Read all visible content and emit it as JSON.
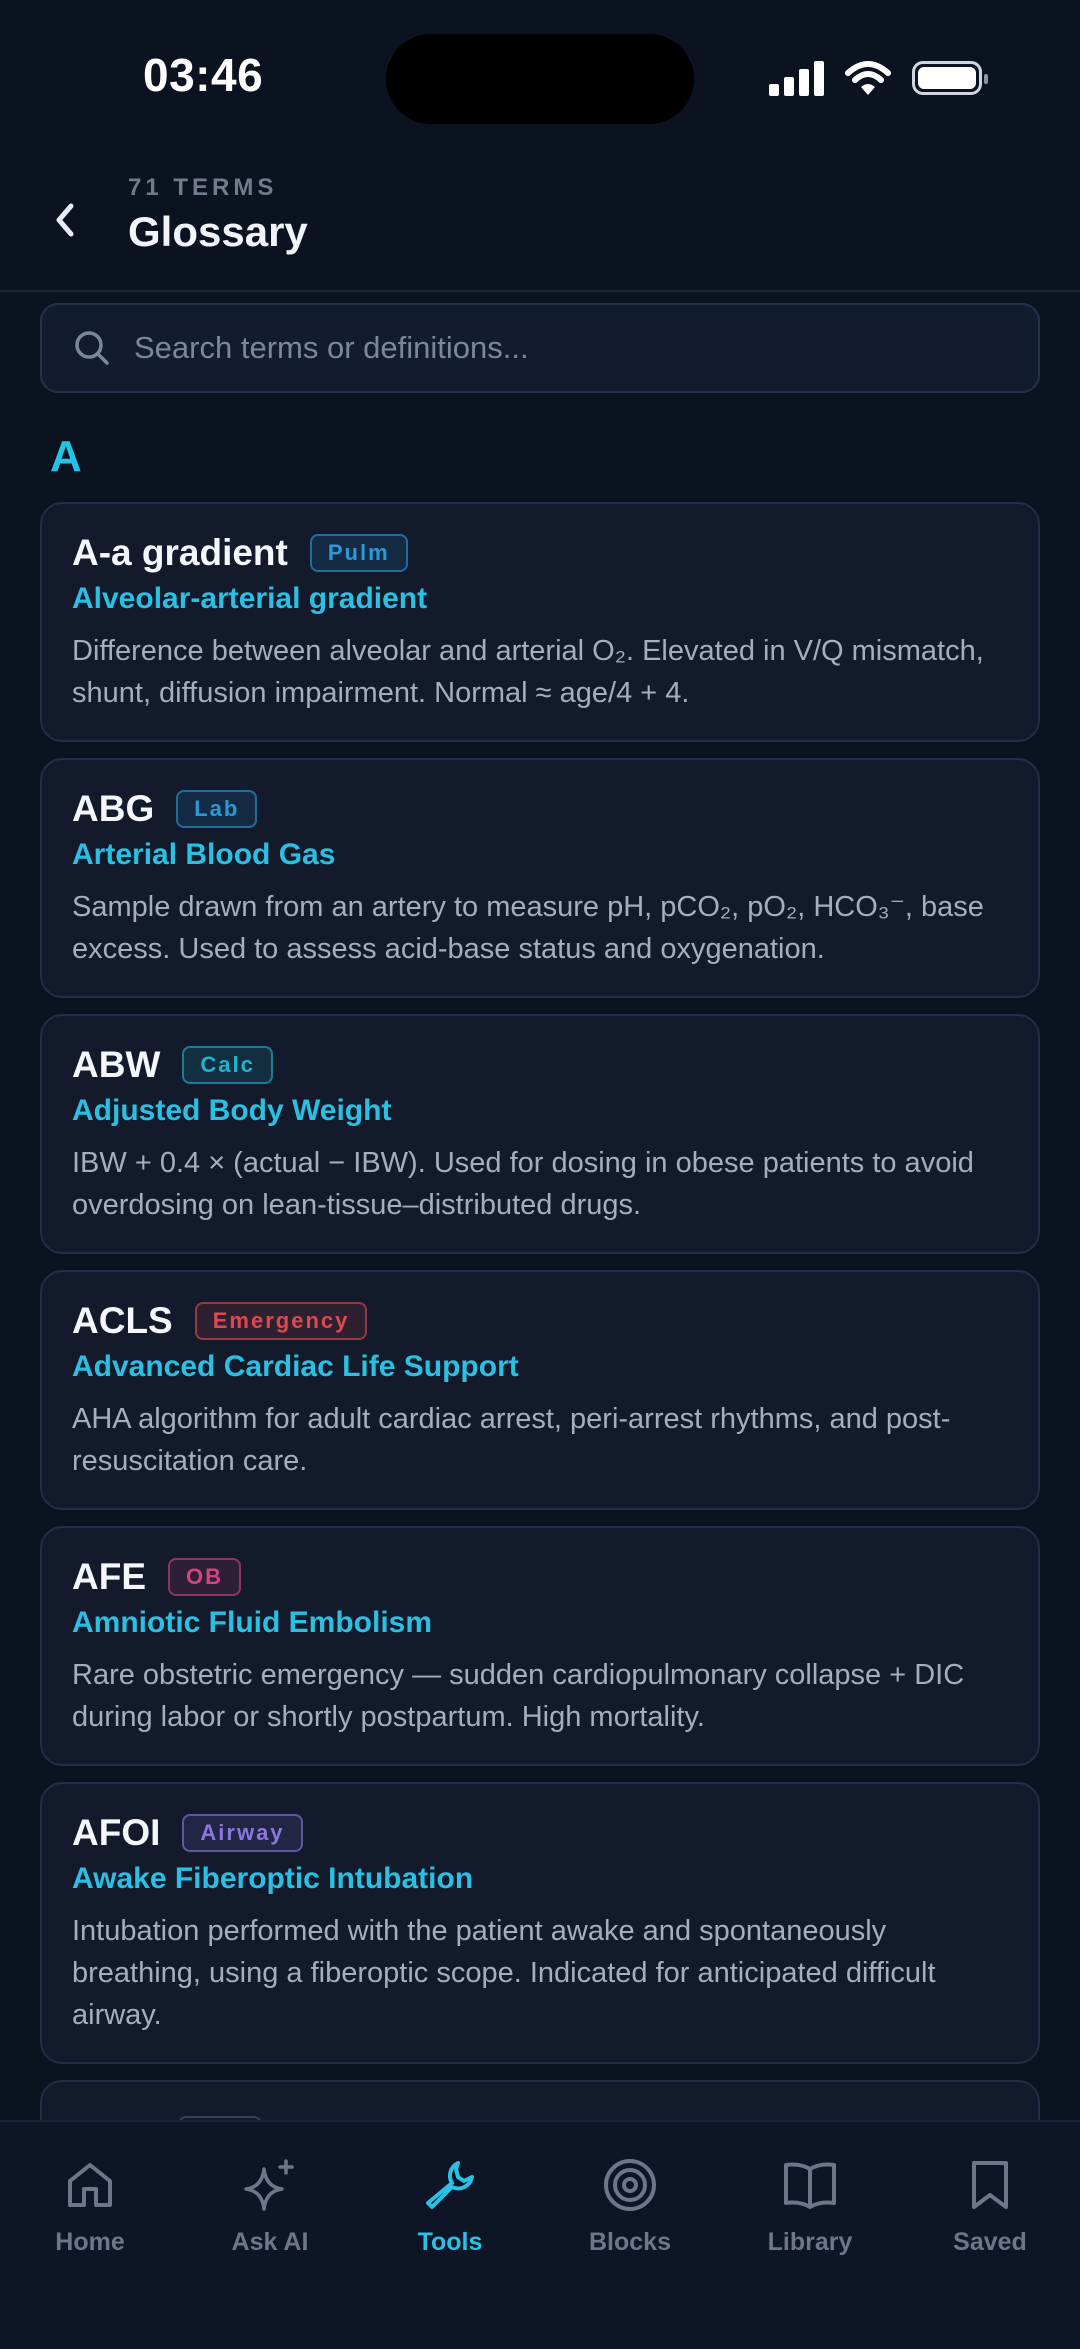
{
  "status_bar": {
    "time": "03:46"
  },
  "header": {
    "count_label": "71 TERMS",
    "title": "Glossary"
  },
  "search": {
    "placeholder": "Search terms or definitions...",
    "value": ""
  },
  "section": {
    "letter": "A"
  },
  "colors": {
    "accent": "#22c3e6",
    "background": "#0b1220",
    "card": "#121a2c"
  },
  "terms": [
    {
      "term": "A-a gradient",
      "tag": "Pulm",
      "tag_color": "#2b9ad6",
      "full_name": "Alveolar-arterial gradient",
      "definition": "Difference between alveolar and arterial O₂. Elevated in V/Q mismatch, shunt, diffusion impairment. Normal ≈ age/4 + 4."
    },
    {
      "term": "ABG",
      "tag": "Lab",
      "tag_color": "#2b9ad6",
      "full_name": "Arterial Blood Gas",
      "definition": "Sample drawn from an artery to measure pH, pCO₂, pO₂, HCO₃⁻, base excess. Used to assess acid-base status and oxygenation."
    },
    {
      "term": "ABW",
      "tag": "Calc",
      "tag_color": "#1fb4c9",
      "full_name": "Adjusted Body Weight",
      "definition": "IBW + 0.4 × (actual − IBW). Used for dosing in obese patients to avoid overdosing on lean-tissue–distributed drugs."
    },
    {
      "term": "ACLS",
      "tag": "Emergency",
      "tag_color": "#e0484f",
      "full_name": "Advanced Cardiac Life Support",
      "definition": "AHA algorithm for adult cardiac arrest, peri-arrest rhythms, and post-resuscitation care."
    },
    {
      "term": "AFE",
      "tag": "OB",
      "tag_color": "#d6437f",
      "full_name": "Amniotic Fluid Embolism",
      "definition": "Rare obstetric emergency — sudden cardiopulmonary collapse + DIC during labor or shortly postpartum. High mortality."
    },
    {
      "term": "AFOI",
      "tag": "Airway",
      "tag_color": "#8a78e0",
      "full_name": "Awake Fiberoptic Intubation",
      "definition": "Intubation performed with the patient awake and spontaneously breathing, using a fiberoptic scope. Indicated for anticipated difficult airway."
    }
  ],
  "tabs": [
    {
      "label": "Home",
      "icon": "home-icon",
      "active": false
    },
    {
      "label": "Ask AI",
      "icon": "sparkles-icon",
      "active": false
    },
    {
      "label": "Tools",
      "icon": "wrench-icon",
      "active": true
    },
    {
      "label": "Blocks",
      "icon": "target-icon",
      "active": false
    },
    {
      "label": "Library",
      "icon": "book-icon",
      "active": false
    },
    {
      "label": "Saved",
      "icon": "bookmark-icon",
      "active": false
    }
  ]
}
